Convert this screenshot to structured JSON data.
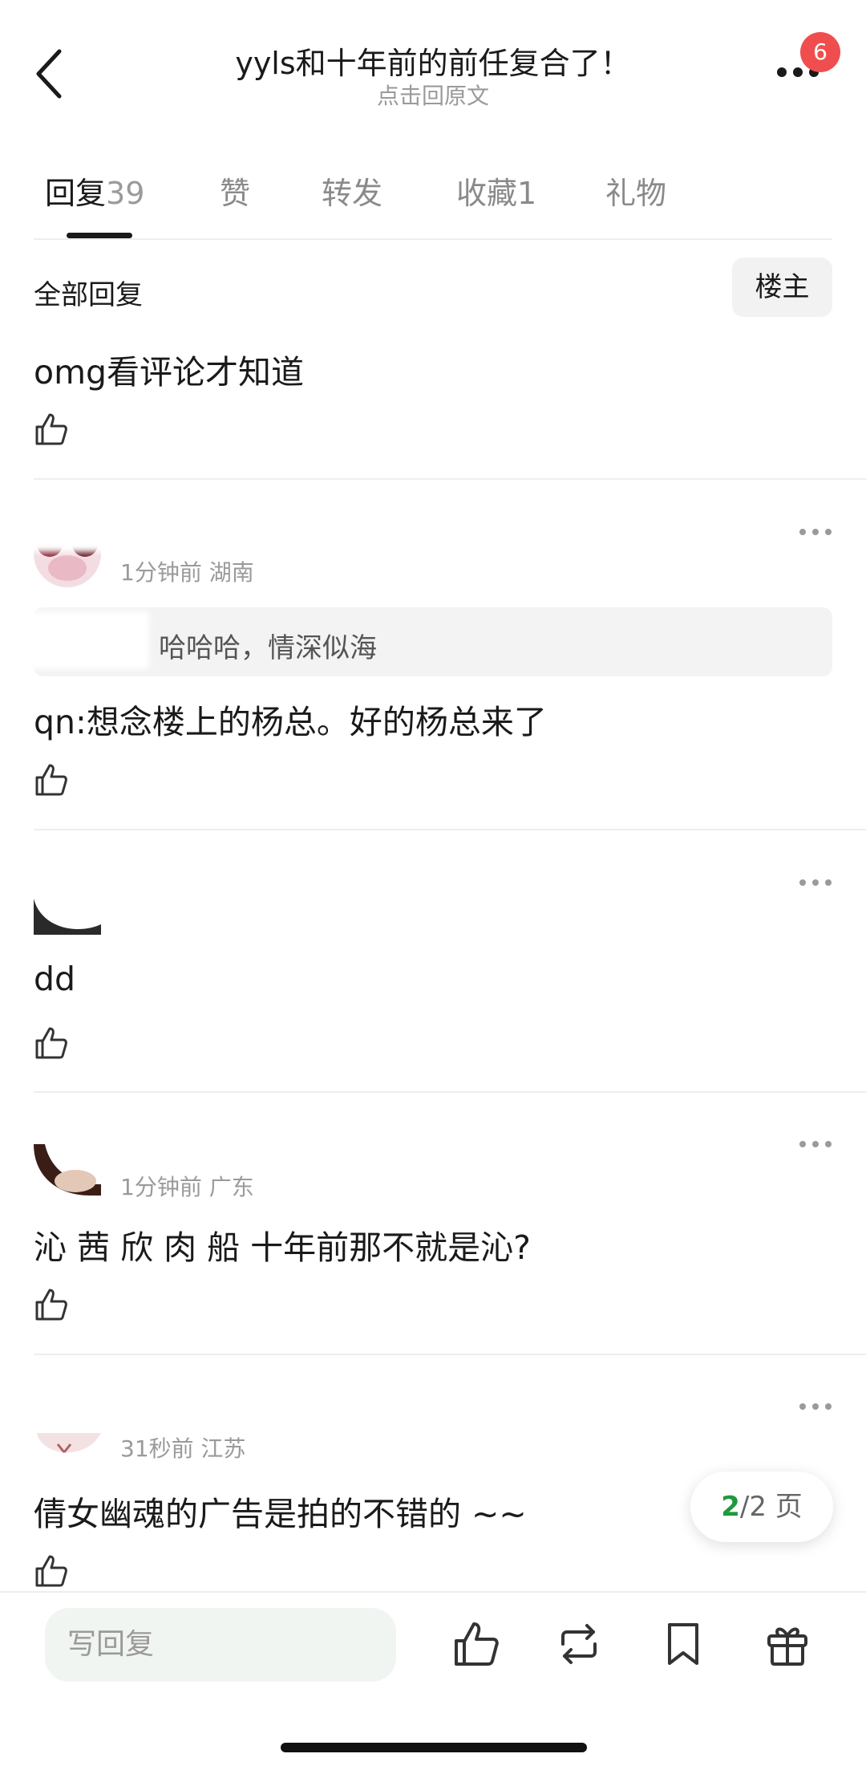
{
  "header": {
    "title": "yyls和十年前的前任复合了！",
    "subtitle": "点击回原文",
    "badge_count": "6"
  },
  "tabs": [
    {
      "label": "回复",
      "count": "39",
      "active": true
    },
    {
      "label": "赞",
      "count": "",
      "active": false
    },
    {
      "label": "转发",
      "count": "",
      "active": false
    },
    {
      "label": "收藏",
      "count": "1",
      "active": false
    },
    {
      "label": "礼物",
      "count": "",
      "active": false
    }
  ],
  "section": {
    "title": "全部回复",
    "op_filter_label": "楼主"
  },
  "comments": [
    {
      "text": "omg看评论才知道",
      "meta": ""
    },
    {
      "text": "qn:想念楼上的杨总。好的杨总来了",
      "meta": "1分钟前 湖南",
      "quote": "哈哈哈，情深似海"
    },
    {
      "text": "dd",
      "meta": ""
    },
    {
      "text": "沁 茜 欣 肉 船 十年前那不就是沁?",
      "meta": "1分钟前 广东"
    },
    {
      "text": "倩女幽魂的广告是拍的不错的 ~~",
      "meta": "31秒前 江苏"
    }
  ],
  "pager": {
    "current": "2",
    "total_text": "/2 页"
  },
  "bottom_bar": {
    "reply_placeholder": "写回复"
  },
  "colors": {
    "accent_green": "#1e9a3c",
    "badge_red": "#f04e4e"
  }
}
